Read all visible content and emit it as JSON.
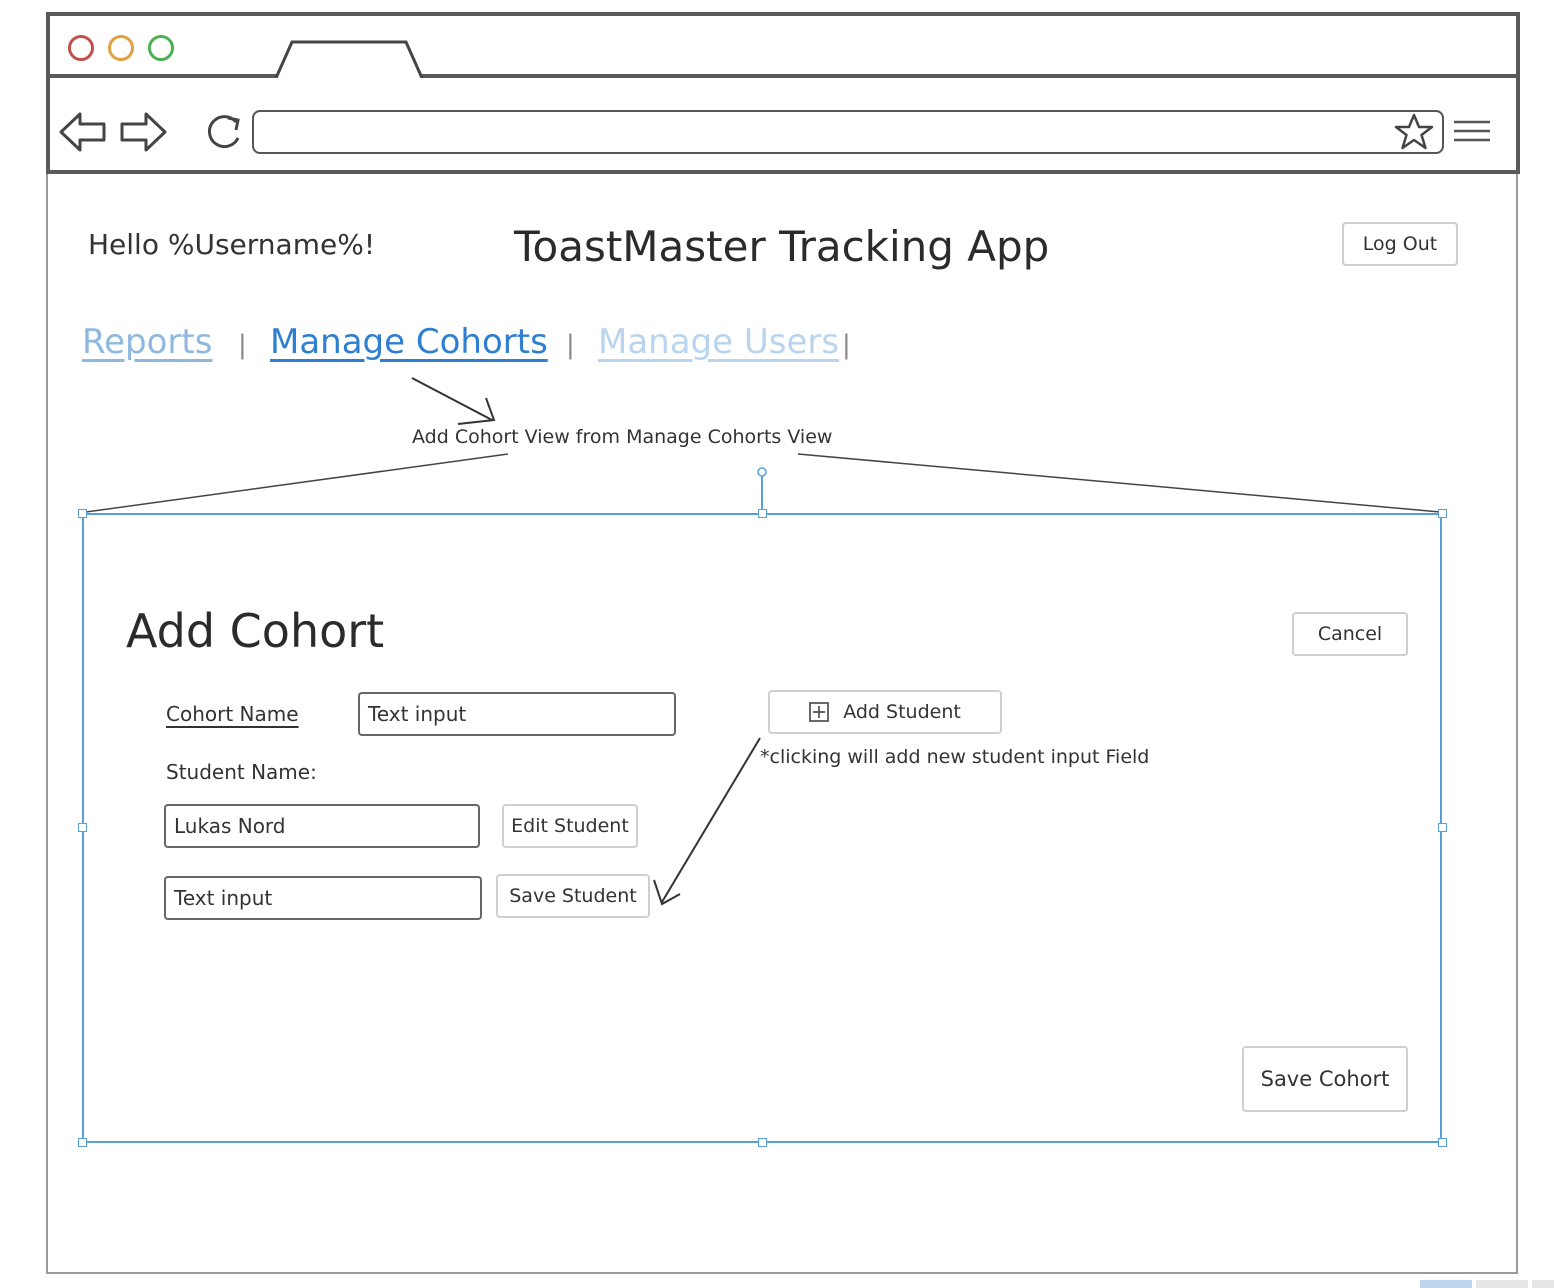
{
  "browser": {
    "window_controls": [
      "close",
      "minimize",
      "maximize"
    ],
    "colors": {
      "close": "#c0504d",
      "minimize": "#e0a040",
      "maximize": "#4caf50"
    }
  },
  "header": {
    "greeting": "Hello %Username%!",
    "app_title": "ToastMaster Tracking App",
    "logout_label": "Log Out"
  },
  "nav": {
    "items": [
      {
        "label": "Reports",
        "color": "#8fb8e0"
      },
      {
        "label": "Manage Cohorts",
        "color": "#2f7fd0"
      },
      {
        "label": "Manage Users",
        "color": "#b9d4ee"
      }
    ],
    "separator": "|"
  },
  "annotation": {
    "callout": "Add Cohort View from Manage Cohorts View",
    "note": "*clicking will add new student input Field"
  },
  "add_cohort": {
    "title": "Add Cohort",
    "cancel_label": "Cancel",
    "cohort_name_label": "Cohort Name",
    "cohort_name_placeholder": "Text input",
    "add_student_label": "Add Student",
    "student_name_label": "Student Name:",
    "students": [
      {
        "value": "Lukas Nord",
        "action": "Edit Student"
      },
      {
        "value": "Text input",
        "action": "Save Student"
      }
    ],
    "save_cohort_label": "Save Cohort"
  }
}
